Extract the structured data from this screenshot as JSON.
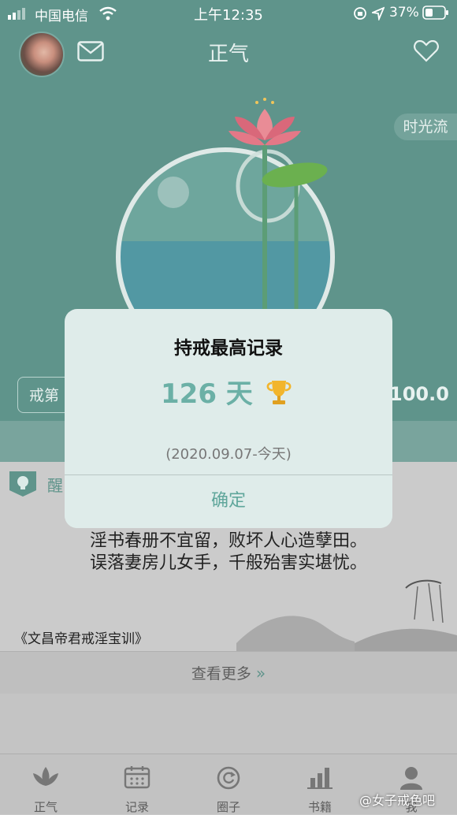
{
  "status_bar": {
    "carrier": "中国电信",
    "time": "上午12:35",
    "battery": "37%"
  },
  "header": {
    "title": "正气",
    "time_flow_label": "时光流"
  },
  "hero": {
    "left_pill_text": "戒第",
    "right_value": "100.0"
  },
  "reminder": {
    "label": "醒"
  },
  "poem": {
    "line1": "淫书春册不宜留，败坏人心造孽田。",
    "line2": "误落妻房儿女手，千般殆害实堪忧。",
    "source": "《文昌帝君戒淫宝训》"
  },
  "more_link": {
    "label": "查看更多"
  },
  "tabs": [
    {
      "label": "正气",
      "icon": "lotus-icon"
    },
    {
      "label": "记录",
      "icon": "calendar-icon"
    },
    {
      "label": "圈子",
      "icon": "refresh-circle-icon"
    },
    {
      "label": "书籍",
      "icon": "bar-chart-icon"
    },
    {
      "label": "我",
      "icon": "user-icon"
    }
  ],
  "watermark": "@女子戒色吧",
  "dialog": {
    "title": "持戒最高记录",
    "days": "126 天",
    "date_range": "(2020.09.07-今天)",
    "confirm_label": "确定"
  }
}
